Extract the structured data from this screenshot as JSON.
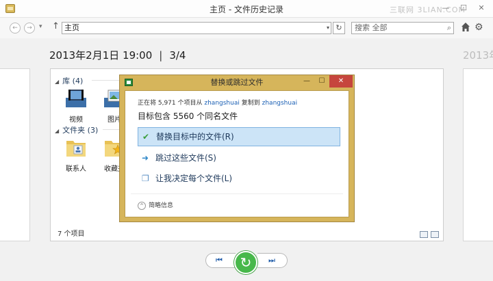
{
  "window": {
    "title": "主页 - 文件历史记录",
    "watermark": "三联网 3LIAN.COM",
    "controls": {
      "minimize": "—",
      "maximize": "☐",
      "close": "✕"
    }
  },
  "navbar": {
    "back": "←",
    "forward": "→",
    "recent": "▾",
    "up": "↑",
    "address": "主页",
    "address_dropdown": "▾",
    "refresh": "↻",
    "search_placeholder": "搜索 全部",
    "search_icon": "⌕",
    "settings_icon": "⚙"
  },
  "header": {
    "date": "2013年2月1日 19:00",
    "separator": "|",
    "position": "3/4",
    "next_date_partial": "2013年"
  },
  "panel": {
    "libraries_label": "库 (4)",
    "libraries_chevron": "◢",
    "libraries": [
      {
        "label": "视频",
        "icon": "video-library-icon"
      },
      {
        "label": "图片",
        "icon": "picture-library-icon"
      }
    ],
    "folders_label": "文件夹 (3)",
    "folders_chevron": "◢",
    "folders": [
      {
        "label": "联系人",
        "icon": "contacts-folder-icon"
      },
      {
        "label": "收藏夹",
        "icon": "favorites-folder-icon"
      }
    ],
    "status": "7 个项目"
  },
  "playback": {
    "previous": "⏮",
    "restore": "↻",
    "next": "⏭"
  },
  "dialog": {
    "title": "替换或跳过文件",
    "copy_prefix": "正在将 5,971 个项目从",
    "source": "zhangshuai",
    "copy_mid": "复制到",
    "destination": "zhangshuai",
    "conflict_line": "目标包含 5560 个同名文件",
    "options": [
      {
        "icon": "✔",
        "label": "替换目标中的文件(R)"
      },
      {
        "icon": "➜",
        "label": "跳过这些文件(S)"
      },
      {
        "icon": "❐",
        "label": "让我决定每个文件(L)"
      }
    ],
    "less_details_icon": "^",
    "less_details": "简略信息",
    "buttons": {
      "minimize": "—",
      "maximize": "☐",
      "close": "✕"
    }
  },
  "colors": {
    "dialog_frame": "#d6b55b",
    "selected_option": "#cce4f7",
    "link": "#1a5fb4",
    "restore_button": "#47b84a",
    "close_button": "#c6463d"
  }
}
